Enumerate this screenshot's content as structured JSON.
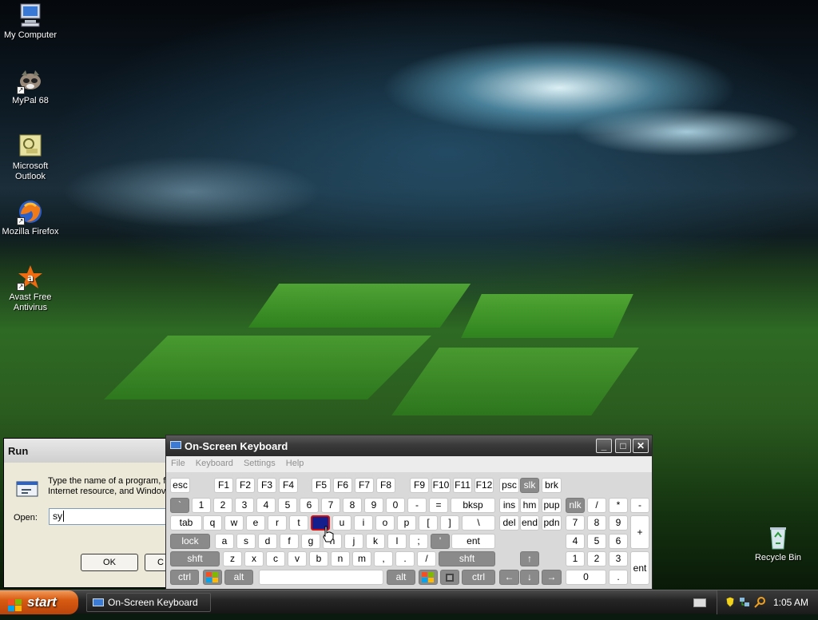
{
  "desktop": {
    "icons": [
      {
        "label": "My Computer",
        "icon": "my-computer-icon"
      },
      {
        "label": "MyPal 68",
        "icon": "mypal-icon"
      },
      {
        "label": "Microsoft Outlook",
        "icon": "outlook-icon"
      },
      {
        "label": "Mozilla Firefox",
        "icon": "firefox-icon"
      },
      {
        "label": "Avast Free Antivirus",
        "icon": "avast-icon"
      },
      {
        "label": "Recycle Bin",
        "icon": "recycle-bin-icon"
      }
    ]
  },
  "run": {
    "title": "Run",
    "message_line1": "Type the name of a program, f",
    "message_line2": "Internet resource, and Windov",
    "open_label": "Open:",
    "open_value": "sy",
    "ok_label": "OK",
    "cancel_label": "C"
  },
  "osk": {
    "title": "On-Screen Keyboard",
    "menu": [
      "File",
      "Keyboard",
      "Settings",
      "Help"
    ],
    "window_buttons": {
      "minimize": "_",
      "maximize": "□",
      "close": "✕"
    },
    "rows": {
      "fn": [
        "esc",
        "F1",
        "F2",
        "F3",
        "F4",
        "F5",
        "F6",
        "F7",
        "F8",
        "F9",
        "F10",
        "F11",
        "F12",
        "psc",
        "slk",
        "brk"
      ],
      "num": [
        "`",
        "1",
        "2",
        "3",
        "4",
        "5",
        "6",
        "7",
        "8",
        "9",
        "0",
        "-",
        "=",
        "bksp",
        "ins",
        "hm",
        "pup",
        "nlk",
        "/",
        "*",
        "-"
      ],
      "qwerty": [
        "tab",
        "q",
        "w",
        "e",
        "r",
        "t",
        "y",
        "u",
        "i",
        "o",
        "p",
        "[",
        "]",
        "\\",
        "del",
        "end",
        "pdn",
        "7",
        "8",
        "9",
        "+"
      ],
      "home": [
        "lock",
        "a",
        "s",
        "d",
        "f",
        "g",
        "h",
        "j",
        "k",
        "l",
        ";",
        "'",
        "ent",
        "4",
        "5",
        "6"
      ],
      "shift": [
        "shft",
        "z",
        "x",
        "c",
        "v",
        "b",
        "n",
        "m",
        ",",
        ".",
        "/",
        "shft",
        "↑",
        "1",
        "2",
        "3",
        "ent"
      ],
      "bottom": [
        "ctrl",
        "win",
        "alt",
        "space",
        "alt",
        "win",
        "menu",
        "ctrl",
        "←",
        "↓",
        "→",
        "0",
        "."
      ]
    },
    "pressed_key": "y"
  },
  "taskbar": {
    "start_label": "start",
    "task_label": "On-Screen Keyboard",
    "clock": "1:05 AM",
    "tray_icons": [
      "keyboard-tray-icon",
      "security-shield-icon",
      "network-icon",
      "search-icon"
    ]
  }
}
